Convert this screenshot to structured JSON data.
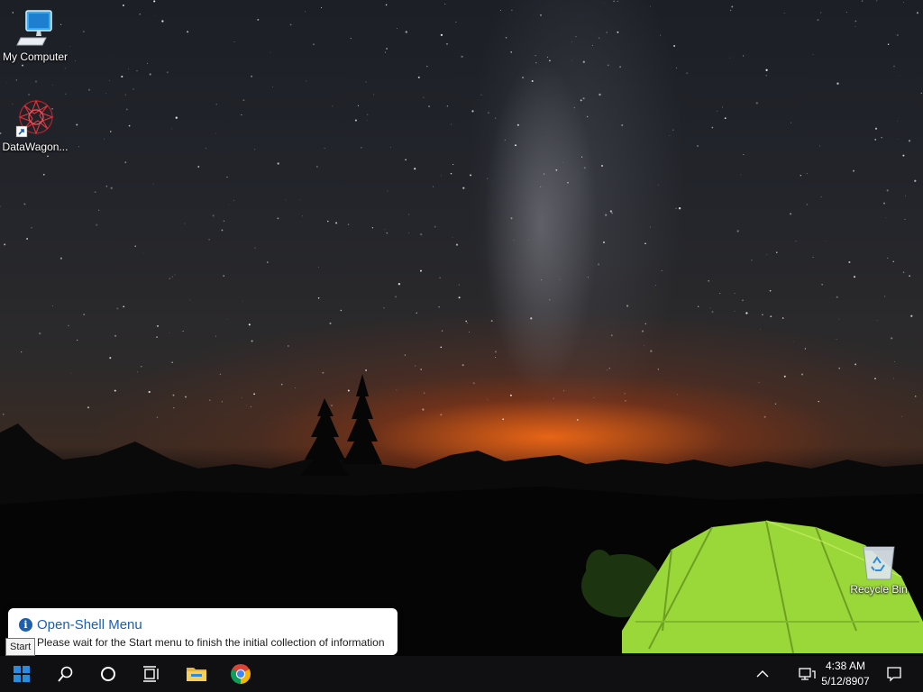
{
  "desktop": {
    "icons": [
      {
        "label": "My Computer",
        "icon": "computer-icon"
      },
      {
        "label": "DataWagon...",
        "icon": "datawagon-shortcut-icon"
      },
      {
        "label": "Recycle Bin",
        "icon": "recycle-bin-icon"
      }
    ]
  },
  "notification": {
    "title": "Open-Shell Menu",
    "message": "Please wait for the Start menu to finish the initial collection of information",
    "icon": "info-icon"
  },
  "tooltip": {
    "text": "Start"
  },
  "taskbar": {
    "start": "windows-start-icon",
    "search": "search-icon",
    "cortana": "cortana-circle-icon",
    "task_view": "task-view-icon",
    "file_explorer": "folder-icon",
    "chrome": "chrome-icon",
    "tray": {
      "chevron": "chevron-up-icon",
      "network": "network-icon",
      "time": "4:38 AM",
      "date": "5/12/8907",
      "action_center": "notification-icon"
    }
  },
  "colors": {
    "taskbar": "#101012",
    "start_blue": "#2b8be0",
    "toast_title": "#1b5fae",
    "tent_green": "#9ad83a"
  }
}
